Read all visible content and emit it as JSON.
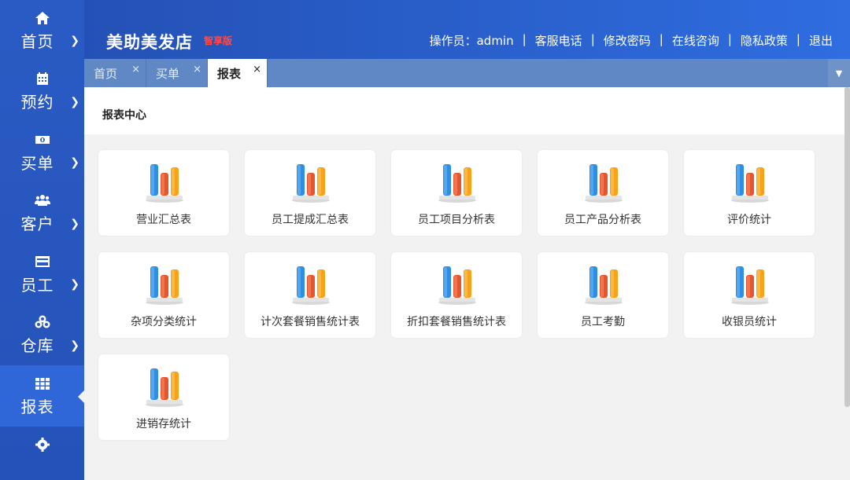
{
  "sidebar": {
    "items": [
      {
        "label": "首页",
        "icon": "home-icon"
      },
      {
        "label": "预约",
        "icon": "calendar-icon"
      },
      {
        "label": "买单",
        "icon": "money-icon"
      },
      {
        "label": "客户",
        "icon": "users-icon"
      },
      {
        "label": "员工",
        "icon": "card-icon"
      },
      {
        "label": "仓库",
        "icon": "cubes-icon"
      },
      {
        "label": "报表",
        "icon": "grid-icon",
        "active": true
      },
      {
        "label": "",
        "icon": "gear-icon"
      }
    ]
  },
  "header": {
    "brand": "美助美发店",
    "edition": "智享版",
    "operator_label": "操作员：admin",
    "links": [
      "客服电话",
      "修改密码",
      "在线咨询",
      "隐私政策",
      "退出"
    ]
  },
  "tabs": [
    {
      "label": "首页",
      "close": "×"
    },
    {
      "label": "买单",
      "close": "×"
    },
    {
      "label": "报表",
      "close": "×",
      "active": true
    }
  ],
  "tab_dropdown": "▼",
  "panel": {
    "title": "报表中心"
  },
  "cards": [
    "营业汇总表",
    "员工提成汇总表",
    "员工项目分析表",
    "员工产品分析表",
    "评价统计",
    "杂项分类统计",
    "计次套餐销售统计表",
    "折扣套餐销售统计表",
    "员工考勤",
    "收银员统计",
    "进销存统计"
  ],
  "colors": {
    "sidebar": "#2a5bc4",
    "header_start": "#2451b5",
    "header_end": "#2f6de0",
    "tabbar": "#5f88c4",
    "bar_blue": "#2f8de4",
    "bar_red": "#e8542c",
    "bar_orange": "#f8a21a"
  }
}
